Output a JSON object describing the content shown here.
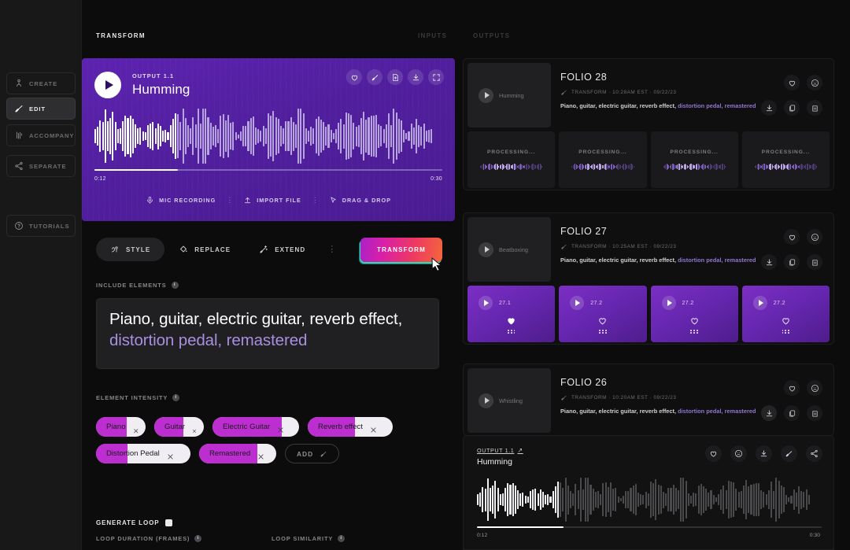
{
  "sidebar": {
    "items": [
      {
        "label": "CREATE",
        "icon": "create-icon",
        "active": false
      },
      {
        "label": "EDIT",
        "icon": "edit-icon",
        "active": true
      },
      {
        "label": "ACCOMPANY",
        "icon": "accompany-icon",
        "active": false
      },
      {
        "label": "SEPARATE",
        "icon": "separate-icon",
        "active": false
      }
    ],
    "tutorials": {
      "label": "TUTORIALS",
      "icon": "question-icon"
    }
  },
  "header": {
    "title": "TRANSFORM",
    "tabs": [
      {
        "label": "INPUTS",
        "name": "tab-inputs"
      },
      {
        "label": "OUTPUTS",
        "name": "tab-outputs"
      }
    ]
  },
  "player": {
    "kicker": "OUTPUT 1.1",
    "title": "Humming",
    "time_current": "0:12",
    "time_total": "0:30",
    "progress_pct": 24,
    "icons": [
      "heart-icon",
      "edit-icon",
      "file-add-icon",
      "download-icon",
      "expand-icon"
    ],
    "sources": [
      {
        "label": "MIC RECORDING",
        "icon": "microphone-icon"
      },
      {
        "label": "IMPORT FILE",
        "icon": "upload-icon"
      },
      {
        "label": "DRAG & DROP",
        "icon": "cursor-icon"
      }
    ]
  },
  "actions": {
    "buttons": [
      {
        "label": "STYLE",
        "icon": "style-icon",
        "selected": true
      },
      {
        "label": "REPLACE",
        "icon": "paint-icon",
        "selected": false
      },
      {
        "label": "EXTEND",
        "icon": "wand-icon",
        "selected": false
      }
    ],
    "kebab": "⋮",
    "transform_label": "TRANSFORM",
    "transform_gradient": "#a822c8 → #f4673c"
  },
  "include_elements": {
    "label": "INCLUDE ELEMENTS",
    "info": "i",
    "text_plain": "Piano, guitar, electric guitar, reverb effect, ",
    "text_highlight": "distortion pedal, remastered"
  },
  "element_intensity": {
    "label": "ELEMENT INTENSITY",
    "info": "i",
    "pills": [
      {
        "name": "Piano",
        "intensity": 62
      },
      {
        "name": "Guitar",
        "intensity": 58
      },
      {
        "name": "Electric Guitar",
        "intensity": 80
      },
      {
        "name": "Reverb effect",
        "intensity": 56
      },
      {
        "name": "Distortion Pedal",
        "intensity": 33
      },
      {
        "name": "Remastered",
        "intensity": 76
      }
    ],
    "add_label": "ADD"
  },
  "loop": {
    "generate_label": "GENERATE LOOP",
    "duration_label": "LOOP DURATION (FRAMES)",
    "similarity_label": "LOOP SIMILARITY",
    "info": "i"
  },
  "right_panel": {
    "folios": [
      {
        "title": "FOLIO 28",
        "thumb_label": "Humming",
        "meta": "TRANSFORM · 10:28AM EST · 09/22/23",
        "desc_plain": "Piano, guitar, electric guitar, reverb effect, ",
        "desc_highlight": "distortion pedal, remastered",
        "icons_top": [
          "heart-icon",
          "sad-face-icon"
        ],
        "icons_bottom": [
          "download-icon",
          "copy-icon",
          "trash-icon"
        ],
        "cards": [
          {
            "type": "processing",
            "label": "PROCESSING..."
          },
          {
            "type": "processing",
            "label": "PROCESSING..."
          },
          {
            "type": "processing",
            "label": "PROCESSING..."
          },
          {
            "type": "processing",
            "label": "PROCESSING..."
          }
        ]
      },
      {
        "title": "FOLIO 27",
        "thumb_label": "Beatboxing",
        "meta": "TRANSFORM · 10:25AM EST · 09/22/23",
        "desc_plain": "Piano, guitar, electric guitar, reverb effect, ",
        "desc_highlight": "distortion pedal, remastered",
        "icons_top": [
          "heart-icon",
          "sad-face-icon"
        ],
        "icons_bottom": [
          "download-icon",
          "copy-icon",
          "trash-icon"
        ],
        "cards": [
          {
            "type": "purple",
            "label": "27.1",
            "favorited": true
          },
          {
            "type": "purple",
            "label": "27.2",
            "favorited": false
          },
          {
            "type": "purple",
            "label": "27.2",
            "favorited": false
          },
          {
            "type": "purple",
            "label": "27.2",
            "favorited": false
          }
        ]
      },
      {
        "title": "FOLIO 26",
        "thumb_label": "Whistling",
        "meta": "TRANSFORM · 10:20AM EST · 09/22/23",
        "desc_plain": "Piano, guitar, electric guitar, reverb effect, ",
        "desc_highlight": "distortion pedal, remastered",
        "icons_top": [
          "heart-icon",
          "sad-face-icon"
        ],
        "icons_bottom": [
          "download-icon",
          "copy-icon",
          "trash-icon"
        ],
        "cards": []
      }
    ]
  },
  "bottom_player": {
    "kicker": "OUTPUT 1.1",
    "external_arrow": "↗",
    "title": "Humming",
    "time_current": "0:12",
    "time_total": "0:30",
    "progress_pct": 25,
    "icons": [
      "heart-icon",
      "sad-face-icon",
      "download-icon",
      "edit-icon",
      "share-icon"
    ]
  },
  "colors": {
    "brand_purple": "#5d23b0",
    "accent_magenta": "#bd2ed0",
    "highlight_text": "#a98fe0",
    "background": "#0c0c0d",
    "sidebar": "#181819"
  }
}
